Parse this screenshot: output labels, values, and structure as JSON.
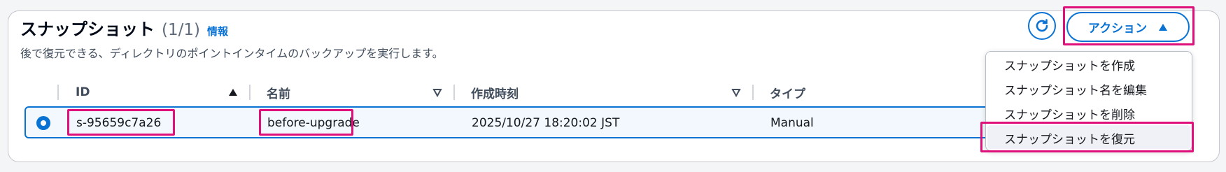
{
  "header": {
    "title": "スナップショット",
    "count": "(1/1)",
    "info_link": "情報",
    "description": "後で復元できる、ディレクトリのポイントインタイムのバックアップを実行します。"
  },
  "toolbar": {
    "refresh_icon": "refresh-icon",
    "actions_label": "アクション"
  },
  "table": {
    "columns": [
      {
        "label": "ID",
        "sort": "ascending"
      },
      {
        "label": "名前",
        "sort": "none"
      },
      {
        "label": "作成時刻",
        "sort": "none"
      },
      {
        "label": "タイプ",
        "sort": "none"
      }
    ],
    "rows": [
      {
        "selected": true,
        "id": "s-95659c7a26",
        "name": "before-upgrade",
        "created": "2025/10/27 18:20:02 JST",
        "type": "Manual"
      }
    ]
  },
  "actions_menu": {
    "items": [
      {
        "label": "スナップショットを作成"
      },
      {
        "label": "スナップショット名を編集"
      },
      {
        "label": "スナップショットを削除"
      },
      {
        "label": "スナップショットを復元"
      }
    ]
  },
  "colors": {
    "accent": "#0972d3",
    "highlight": "#e0107a",
    "selected_row_bg": "#f2f8fd"
  }
}
